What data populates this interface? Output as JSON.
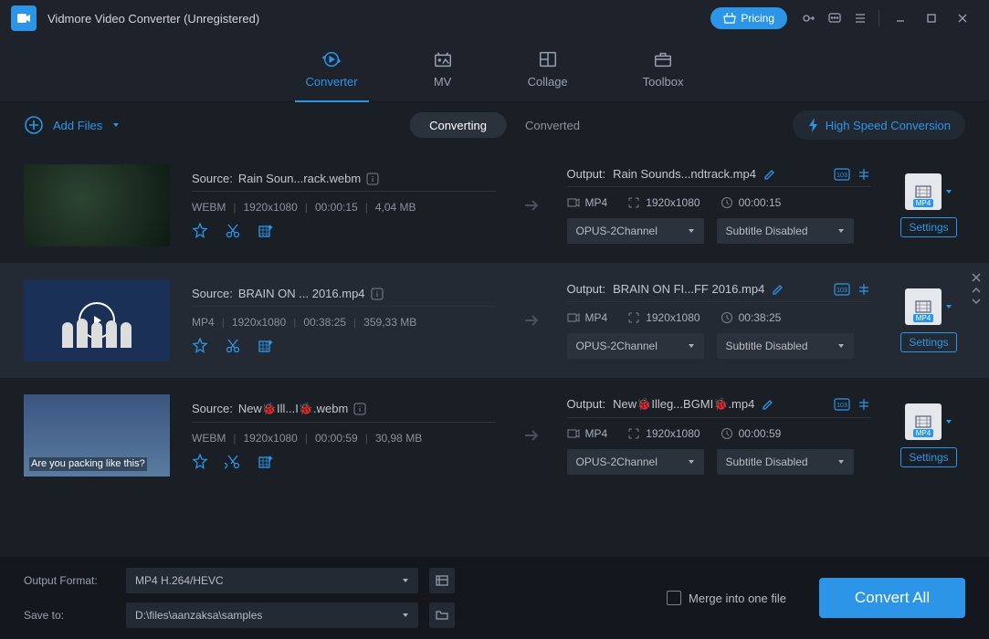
{
  "title": "Vidmore Video Converter (Unregistered)",
  "pricing": "Pricing",
  "tabs": {
    "converter": "Converter",
    "mv": "MV",
    "collage": "Collage",
    "toolbox": "Toolbox"
  },
  "sub": {
    "add_files": "Add Files",
    "converting": "Converting",
    "converted": "Converted",
    "hsc": "High Speed Conversion"
  },
  "rows": [
    {
      "source_label": "Source:",
      "source_name": "Rain Soun...rack.webm",
      "fmt": "WEBM",
      "res": "1920x1080",
      "dur": "00:00:15",
      "size": "4,04 MB",
      "output_label": "Output:",
      "output_name": "Rain Sounds...ndtrack.mp4",
      "out_fmt": "MP4",
      "out_res": "1920x1080",
      "out_dur": "00:00:15",
      "audio": "OPUS-2Channel",
      "subtitle": "Subtitle Disabled",
      "badge": "MP4",
      "settings": "Settings"
    },
    {
      "source_label": "Source:",
      "source_name": "BRAIN ON ... 2016.mp4",
      "fmt": "MP4",
      "res": "1920x1080",
      "dur": "00:38:25",
      "size": "359,33 MB",
      "output_label": "Output:",
      "output_name": "BRAIN ON FI...FF 2016.mp4",
      "out_fmt": "MP4",
      "out_res": "1920x1080",
      "out_dur": "00:38:25",
      "audio": "OPUS-2Channel",
      "subtitle": "Subtitle Disabled",
      "badge": "MP4",
      "settings": "Settings"
    },
    {
      "source_label": "Source:",
      "source_name": "New🐞Ill...I🐞.webm",
      "fmt": "WEBM",
      "res": "1920x1080",
      "dur": "00:00:59",
      "size": "30,98 MB",
      "output_label": "Output:",
      "output_name": "New🐞Illeg...BGMI🐞.mp4",
      "out_fmt": "MP4",
      "out_res": "1920x1080",
      "out_dur": "00:00:59",
      "audio": "OPUS-2Channel",
      "subtitle": "Subtitle Disabled",
      "badge": "MP4",
      "settings": "Settings"
    }
  ],
  "footer": {
    "outfmt_lbl": "Output Format:",
    "outfmt_val": "MP4 H.264/HEVC",
    "saveto_lbl": "Save to:",
    "saveto_val": "D:\\files\\aanzaksa\\samples",
    "merge": "Merge into one file",
    "convert": "Convert All"
  }
}
